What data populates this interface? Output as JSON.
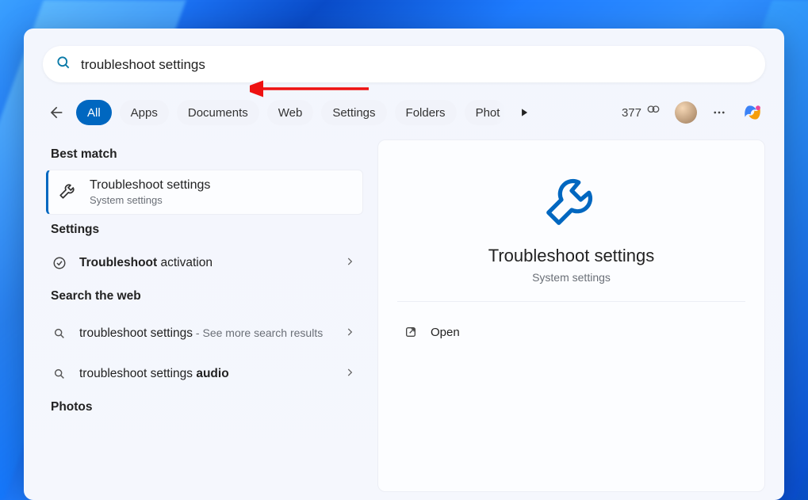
{
  "search": {
    "query": "troubleshoot settings"
  },
  "tabs": {
    "items": [
      "All",
      "Apps",
      "Documents",
      "Web",
      "Settings",
      "Folders",
      "Phot"
    ],
    "active_index": 0
  },
  "header": {
    "points": "377"
  },
  "left": {
    "best_match_header": "Best match",
    "best_match": {
      "title": "Troubleshoot settings",
      "subtitle": "System settings"
    },
    "settings_header": "Settings",
    "settings_item": {
      "bold": "Troubleshoot",
      "rest": " activation"
    },
    "search_web_header": "Search the web",
    "web1": {
      "main": "troubleshoot settings",
      "sub": " - See more search results"
    },
    "web2": {
      "main": "troubleshoot settings ",
      "bold": "audio"
    },
    "photos_header": "Photos"
  },
  "right": {
    "title": "Troubleshoot settings",
    "subtitle": "System settings",
    "open_label": "Open"
  }
}
